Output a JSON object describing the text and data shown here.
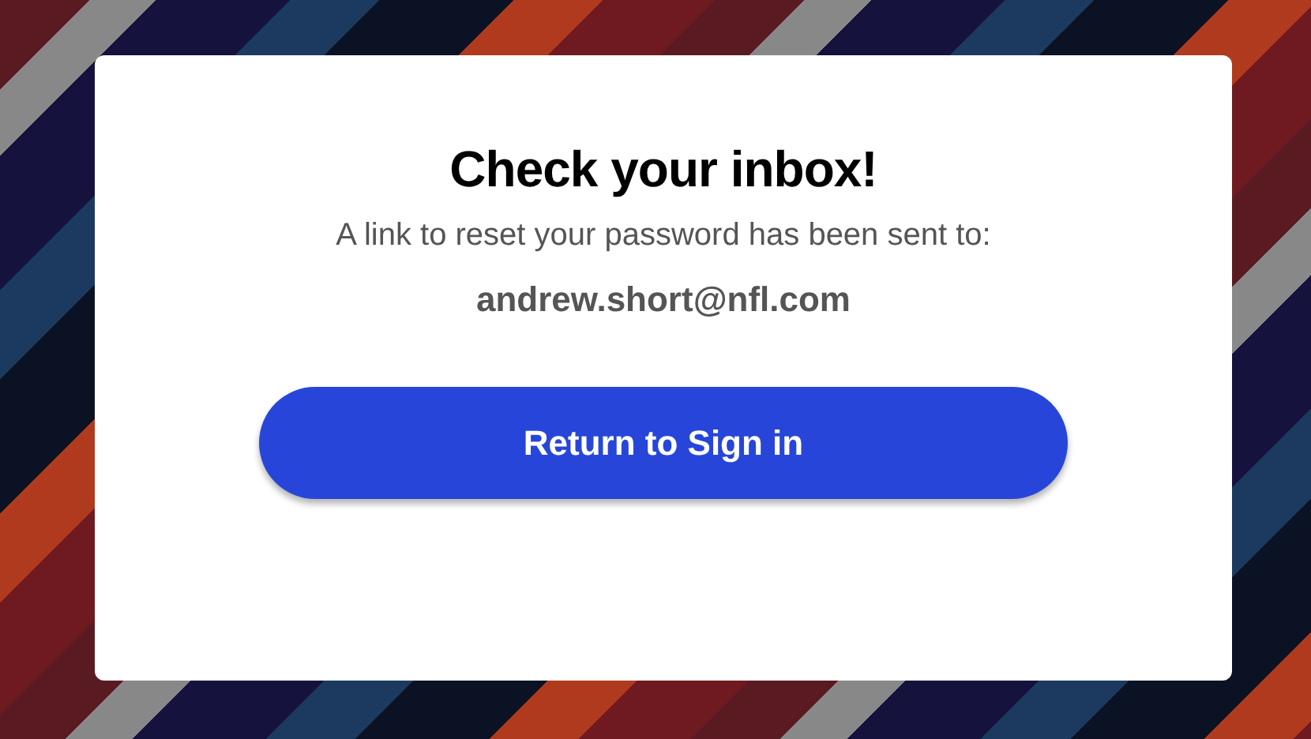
{
  "dialog": {
    "title": "Check your inbox!",
    "message": "A link to reset your password has been sent to:",
    "email": "andrew.short@nfl.com",
    "button": "Return to Sign in"
  }
}
